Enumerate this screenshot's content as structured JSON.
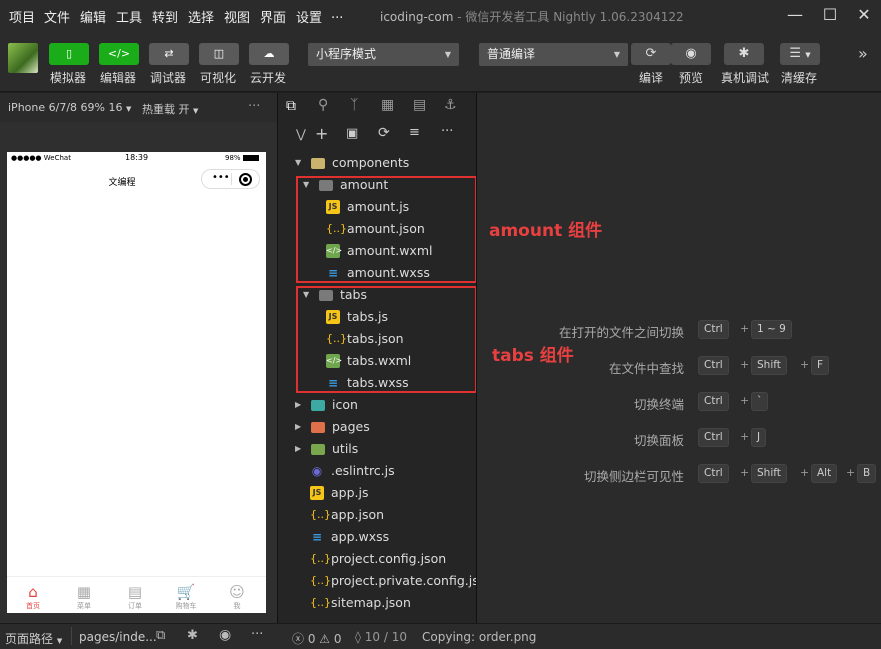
{
  "menu": [
    "项目",
    "文件",
    "编辑",
    "工具",
    "转到",
    "选择",
    "视图",
    "界面",
    "设置",
    "..."
  ],
  "window": {
    "title": "icoding-com",
    "subtitle": "- 微信开发者工具 Nightly 1.06.2304122"
  },
  "toolbar": {
    "left": [
      {
        "label": "模拟器",
        "icon": "phone-icon"
      },
      {
        "label": "编辑器",
        "icon": "code-icon"
      },
      {
        "label": "调试器",
        "icon": "debug-icon"
      },
      {
        "label": "可视化",
        "icon": "visual-icon"
      },
      {
        "label": "云开发",
        "icon": "cloud-icon"
      }
    ],
    "mode_select": "小程序模式",
    "compile_select": "普通编译",
    "right": [
      {
        "label": "编译",
        "icon": "refresh-icon"
      },
      {
        "label": "预览",
        "icon": "eye-icon"
      },
      {
        "label": "真机调试",
        "icon": "bug-icon"
      },
      {
        "label": "清缓存",
        "icon": "layers-icon"
      }
    ]
  },
  "simulator": {
    "device": "iPhone 6/7/8 69% 16",
    "hotreload": "热重载 开",
    "more": "···",
    "status": {
      "signal": "●●●●● WeChat",
      "time": "18:39",
      "battery": "98%"
    },
    "nav_title": "文编程",
    "tabbar": [
      {
        "label": "首页",
        "icon": "home-icon",
        "active": true
      },
      {
        "label": "菜单",
        "icon": "grid-icon",
        "active": false
      },
      {
        "label": "订单",
        "icon": "order-icon",
        "active": false
      },
      {
        "label": "购物车",
        "icon": "cart-icon",
        "active": false
      },
      {
        "label": "我",
        "icon": "user-icon",
        "active": false
      }
    ]
  },
  "explorer": {
    "tree": [
      {
        "name": "components",
        "type": "folder-open",
        "depth": 0,
        "expanded": true
      },
      {
        "name": "amount",
        "type": "folder-open-plain",
        "depth": 1,
        "expanded": true
      },
      {
        "name": "amount.js",
        "type": "js",
        "depth": 2
      },
      {
        "name": "amount.json",
        "type": "json",
        "depth": 2
      },
      {
        "name": "amount.wxml",
        "type": "wxml",
        "depth": 2
      },
      {
        "name": "amount.wxss",
        "type": "wxss",
        "depth": 2
      },
      {
        "name": "tabs",
        "type": "folder-open-plain",
        "depth": 1,
        "expanded": true
      },
      {
        "name": "tabs.js",
        "type": "js",
        "depth": 2
      },
      {
        "name": "tabs.json",
        "type": "json",
        "depth": 2
      },
      {
        "name": "tabs.wxml",
        "type": "wxml",
        "depth": 2
      },
      {
        "name": "tabs.wxss",
        "type": "wxss",
        "depth": 2
      },
      {
        "name": "icon",
        "type": "folder-teal",
        "depth": 0,
        "expanded": false
      },
      {
        "name": "pages",
        "type": "folder-orange",
        "depth": 0,
        "expanded": false
      },
      {
        "name": "utils",
        "type": "folder-green",
        "depth": 0,
        "expanded": false
      },
      {
        "name": ".eslintrc.js",
        "type": "eslint",
        "depth": 0
      },
      {
        "name": "app.js",
        "type": "js",
        "depth": 0
      },
      {
        "name": "app.json",
        "type": "json",
        "depth": 0
      },
      {
        "name": "app.wxss",
        "type": "wxss",
        "depth": 0
      },
      {
        "name": "project.config.json",
        "type": "json",
        "depth": 0
      },
      {
        "name": "project.private.config.js...",
        "type": "json",
        "depth": 0
      },
      {
        "name": "sitemap.json",
        "type": "json",
        "depth": 0
      }
    ]
  },
  "annotations": {
    "amount": "amount 组件",
    "tabs": "tabs 组件"
  },
  "shortcuts": [
    {
      "label": "在打开的文件之间切换",
      "keys": [
        "Ctrl",
        "1 ~ 9"
      ]
    },
    {
      "label": "在文件中查找",
      "keys": [
        "Ctrl",
        "Shift",
        "F"
      ]
    },
    {
      "label": "切换终端",
      "keys": [
        "Ctrl",
        "`"
      ]
    },
    {
      "label": "切换面板",
      "keys": [
        "Ctrl",
        "J"
      ]
    },
    {
      "label": "切换侧边栏可见性",
      "keys": [
        "Ctrl",
        "Shift",
        "Alt",
        "B"
      ]
    }
  ],
  "status": {
    "page_path_label": "页面路径",
    "page_path": "pages/inde...",
    "errors": "0",
    "warnings": "0",
    "position": "10 / 10",
    "message": "Copying: order.png"
  },
  "colors": {
    "accent": "#1aad19",
    "annotation": "#e03030",
    "active_tab": "#e64340"
  }
}
